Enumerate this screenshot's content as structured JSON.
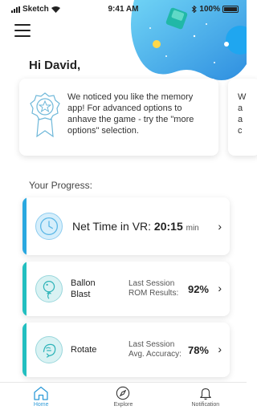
{
  "status_bar": {
    "carrier": "Sketch",
    "time": "9:41 AM",
    "battery": "100%"
  },
  "greeting": "Hi David,",
  "message_card": {
    "text": "We noticed you like the memory app! For advanced options to anhave the game - try the \"more options\" selection."
  },
  "message_card_peek": {
    "text": "W\na\na\nc"
  },
  "progress": {
    "title": "Your Progress:",
    "vr": {
      "label": "Net Time in VR:",
      "value": "20:15",
      "unit": "min",
      "accent": "#2aa8e0",
      "icon": "clock-icon"
    },
    "games": [
      {
        "name_line1": "Ballon",
        "name_line2": "Blast",
        "metric_line1": "Last Session",
        "metric_line2": "ROM Results:",
        "value": "92%",
        "accent": "#22bfc0",
        "icon": "balloon-icon"
      },
      {
        "name_line1": "Rotate",
        "name_line2": "",
        "metric_line1": "Last Session",
        "metric_line2": "Avg. Accuracy:",
        "value": "78%",
        "accent": "#22bfc0",
        "icon": "rotate-icon"
      }
    ]
  },
  "tabs": [
    {
      "label": "Home",
      "icon": "home-icon",
      "active": true
    },
    {
      "label": "Explore",
      "icon": "compass-icon",
      "active": false
    },
    {
      "label": "Notification",
      "icon": "bell-icon",
      "active": false
    }
  ],
  "colors": {
    "accent_blue": "#2f9bd8",
    "accent_teal": "#22bfc0"
  }
}
